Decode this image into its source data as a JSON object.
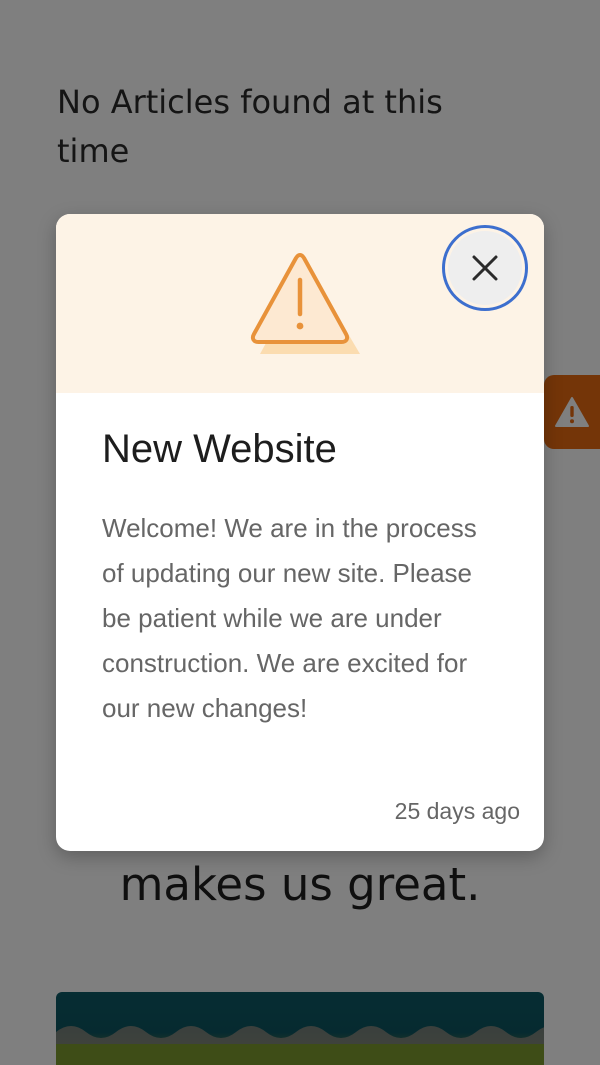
{
  "page": {
    "empty_message": "No Articles found at this time",
    "hero_text": "makes us great."
  },
  "alert_tab": {
    "icon": "warning-icon",
    "color": "#e86a10"
  },
  "modal": {
    "icon": "warning-triangle-icon",
    "header_color": "#fdf3e6",
    "accent_color": "#e89a46",
    "close_icon": "close-icon",
    "title": "New Website",
    "body": "Welcome! We are in the process of updating our new site. Please be patient while we are under construction. We are excited for our new changes!",
    "timestamp": "25 days ago"
  }
}
